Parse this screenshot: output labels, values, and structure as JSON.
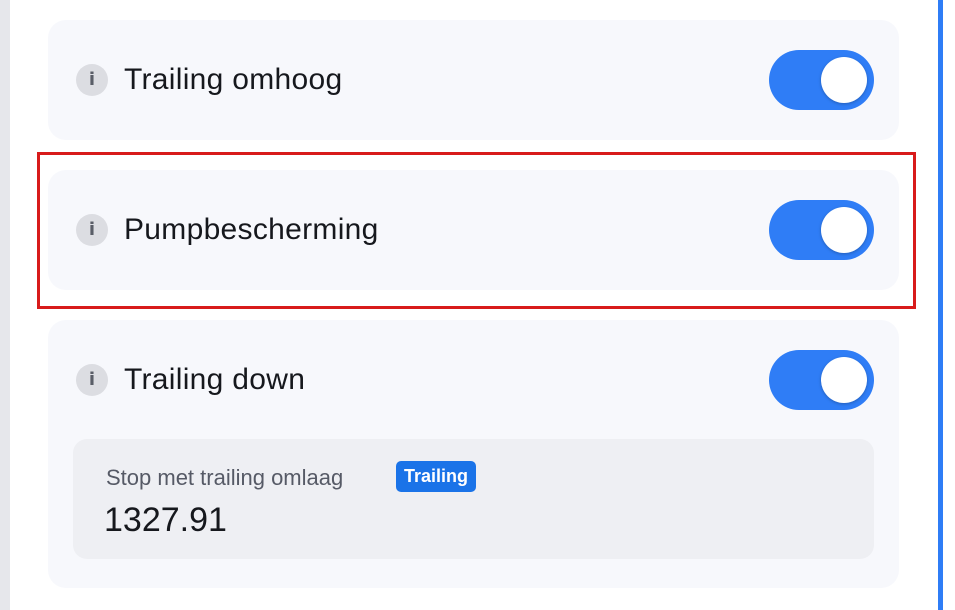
{
  "settings": [
    {
      "label": "Trailing omhoog",
      "info_icon": "info-icon",
      "toggle_on": true
    },
    {
      "label": "Pumpbescherming",
      "info_icon": "info-icon",
      "toggle_on": true
    },
    {
      "label": "Trailing down",
      "info_icon": "info-icon",
      "toggle_on": true,
      "detail": {
        "label": "Stop met trailing omlaag",
        "badge": "Trailing",
        "value": "1327.91"
      }
    }
  ],
  "info_glyph": "i",
  "colors": {
    "accent": "#2f7df6",
    "badge": "#1a73e8",
    "highlight": "#d81b1b",
    "card": "#f7f8fc",
    "sub_panel": "#eeeff3"
  }
}
